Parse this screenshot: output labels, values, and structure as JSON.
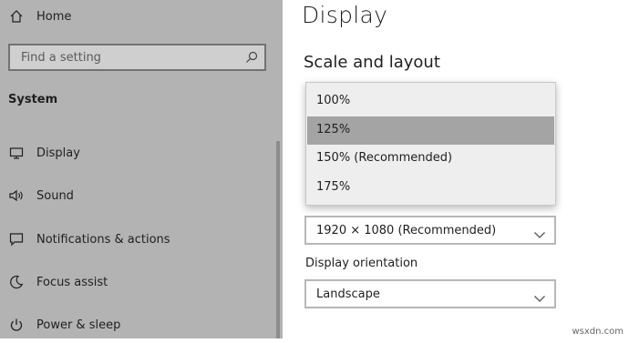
{
  "sidebar": {
    "home_label": "Home",
    "search_placeholder": "Find a setting",
    "section_title": "System",
    "items": [
      {
        "label": "Display",
        "icon": "monitor-icon"
      },
      {
        "label": "Sound",
        "icon": "speaker-icon"
      },
      {
        "label": "Notifications & actions",
        "icon": "notification-icon"
      },
      {
        "label": "Focus assist",
        "icon": "moon-icon"
      },
      {
        "label": "Power & sleep",
        "icon": "power-icon"
      }
    ]
  },
  "main": {
    "title": "Display",
    "section_heading": "Scale and layout",
    "scale_dropdown": {
      "options": [
        "100%",
        "125%",
        "150% (Recommended)",
        "175%"
      ],
      "highlighted": "125%"
    },
    "resolution_value": "1920 × 1080 (Recommended)",
    "orientation_label": "Display orientation",
    "orientation_value": "Landscape"
  },
  "watermark": "wsxdn.com",
  "colors": {
    "sidebar_bg": "#b3b3b3",
    "dropdown_bg": "#eeeeee",
    "highlight": "#a4a4a4"
  }
}
